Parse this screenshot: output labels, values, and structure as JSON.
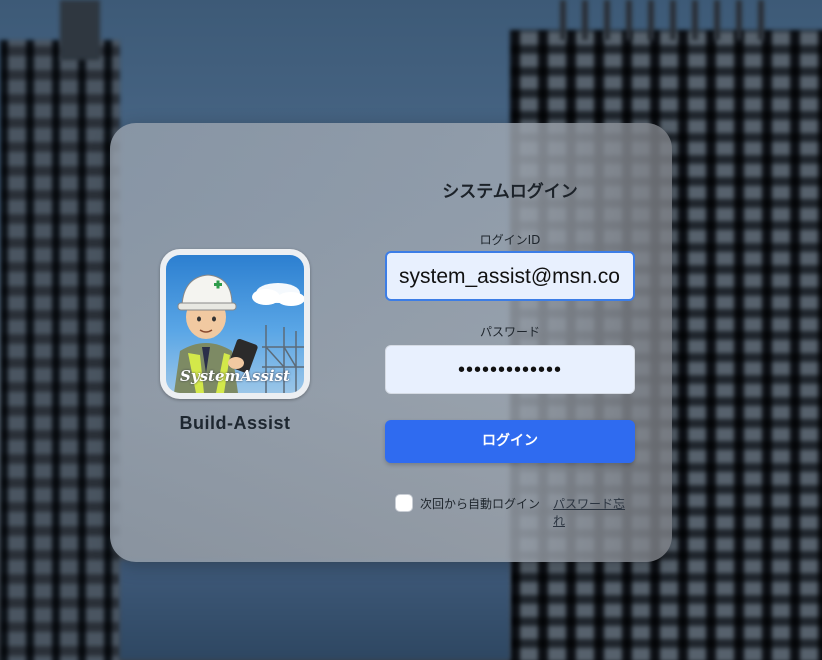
{
  "app": {
    "name": "Build-Assist",
    "logo_text": "SystemAssist"
  },
  "login": {
    "title": "システムログイン",
    "id_label": "ログインID",
    "id_value": "system_assist@msn.co",
    "password_label": "パスワード",
    "password_value": "•••••••••••••",
    "login_button": "ログイン",
    "remember_label": "次回から自動ログイン",
    "forgot_link": "パスワード忘れ"
  },
  "colors": {
    "accent": "#2f6bf0",
    "input_bg": "#e8f0fe",
    "focus_border": "#3c7de6"
  }
}
